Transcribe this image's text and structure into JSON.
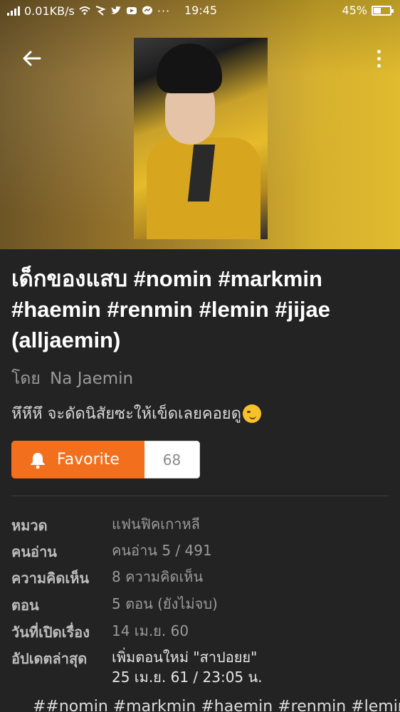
{
  "status_bar": {
    "network_speed": "0.01KB/s",
    "time": "19:45",
    "battery_percent": "45%",
    "battery_level": 0.45
  },
  "header": {
    "back_icon": "arrow-left-icon",
    "more_icon": "more-vertical-icon"
  },
  "story": {
    "title": "เด็กของแสบ #nomin #markmin #haemin #renmin #lemin #jijae (alljaemin)",
    "author_prefix": "โดย",
    "author_name": "Na Jaemin",
    "tagline": "หึหึหึ จะดัดนิสัยซะให้เข็ดเลยคอยดู",
    "tagline_emoji": "smirk-face-icon"
  },
  "favorite": {
    "label": "Favorite",
    "count": "68",
    "icon": "bell-icon",
    "color": "#f26f1d"
  },
  "info": [
    {
      "label": "หมวด",
      "value": "แฟนฟิคเกาหลี"
    },
    {
      "label": "คนอ่าน",
      "value": "คนอ่าน 5 / 491"
    },
    {
      "label": "ความคิดเห็น",
      "value": "8 ความคิดเห็น"
    },
    {
      "label": "ตอน",
      "value": "5 ตอน (ยังไม่จบ)"
    },
    {
      "label": "วันที่เปิดเรื่อง",
      "value": "14 เม.ย. 60"
    },
    {
      "label": "อัปเดตล่าสุด",
      "value": "เพิ่มตอนใหม่ \"สาปอยย\"",
      "value2": "25 เม.ย. 61 / 23:05 น."
    }
  ],
  "tags_line": "##nomin #markmin #haemin #renmin #lemin"
}
